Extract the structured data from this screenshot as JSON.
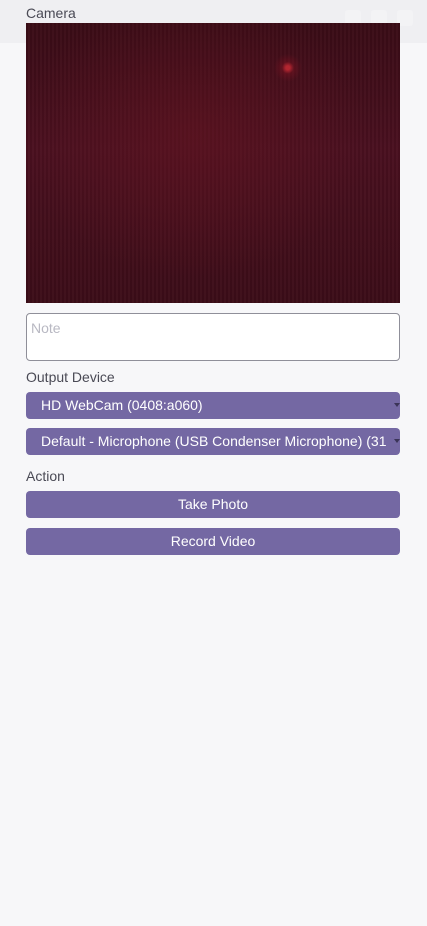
{
  "camera": {
    "label": "Camera"
  },
  "note": {
    "placeholder": "Note",
    "value": ""
  },
  "output": {
    "label": "Output Device",
    "video_device": "HD WebCam (0408:a060)",
    "audio_device": "Default - Microphone (USB Condenser Microphone) (31"
  },
  "action": {
    "label": "Action",
    "take_photo": "Take Photo",
    "record_video": "Record Video"
  },
  "colors": {
    "accent": "#7468a3",
    "background": "#f7f7f9"
  }
}
